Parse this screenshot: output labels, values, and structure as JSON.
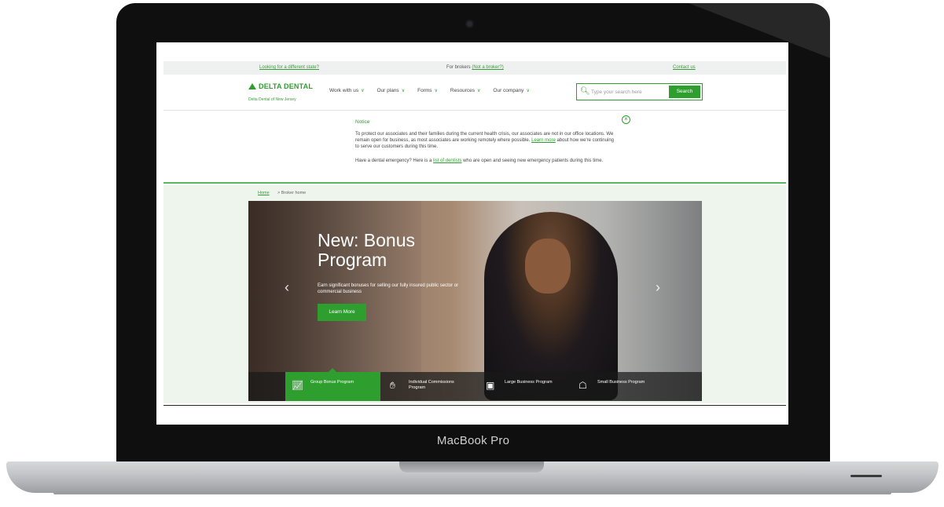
{
  "device": {
    "brand_label": "MacBook Pro"
  },
  "topbar": {
    "different_state": "Looking for a different state?",
    "brokers_prefix": "For brokers",
    "not_broker": "(Not a broker?)",
    "contact": "Contact us"
  },
  "header": {
    "logo": "DELTA DENTAL",
    "logo_sub": "Delta Dental of New Jersey",
    "menu": [
      "Work with us",
      "Our plans",
      "Forms",
      "Resources",
      "Our company"
    ],
    "search_placeholder": "Type your search here",
    "search_button": "Search"
  },
  "notice": {
    "title": "Notice",
    "p1_a": "To protect our associates and their families during the current health crisis, our associates are not in our office locations. We remain open for business, as most associates are working remotely where possible. ",
    "p1_link": "Learn more",
    "p1_b": " about how we're continuing to serve our customers during this time.",
    "p2_a": "Have a dental emergency? Here is a ",
    "p2_link": "list of dentists",
    "p2_b": " who are open and seeing new emergency patients during this time."
  },
  "breadcrumb": {
    "home": "Home",
    "current": "> Broker home"
  },
  "hero": {
    "title": "New: Bonus Program",
    "subtitle": "Earn significant bonuses for selling our fully insured public sector or commercial business",
    "cta": "Learn More",
    "tabs": [
      {
        "label": "Group Bonus Program",
        "icon": "chart-up-icon",
        "active": true
      },
      {
        "label": "Individual Commissions Program",
        "icon": "hand-coin-icon",
        "active": false
      },
      {
        "label": "Large Business Program",
        "icon": "building-icon",
        "active": false
      },
      {
        "label": "Small Business Program",
        "icon": "store-icon",
        "active": false
      }
    ]
  },
  "colors": {
    "brand_green": "#2e9f2e",
    "hero_band": "#edf5ec"
  }
}
